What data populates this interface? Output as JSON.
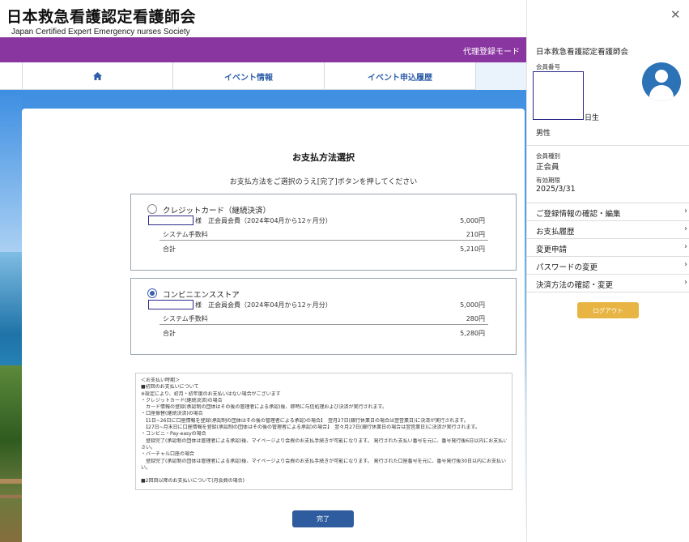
{
  "header": {
    "org_jp": "日本救急看護認定看護師会",
    "org_en": "Japan Certified Expert Emergency nurses Society",
    "mode_label": "代理登録モード"
  },
  "nav": {
    "home_icon": "home-icon",
    "items": [
      "イベント情報",
      "イベント申込履歴"
    ]
  },
  "main": {
    "title": "お支払方法選択",
    "instruction": "お支払方法をご選択のうえ[完了]ボタンを押してください",
    "options": [
      {
        "label": "クレジットカード（継続決済）",
        "selected": false,
        "fee_line": "様　正会員会費（2024年04月から12ヶ月分）",
        "fee_value": "5,000円",
        "system_fee_label": "システム手数料",
        "system_fee_value": "210円",
        "total_label": "合計",
        "total_value": "5,210円"
      },
      {
        "label": "コンビニエンスストア",
        "selected": true,
        "fee_line": "様　正会員会費（2024年04月から12ヶ月分）",
        "fee_value": "5,000円",
        "system_fee_label": "システム手数料",
        "system_fee_value": "280円",
        "total_label": "合計",
        "total_value": "5,280円"
      }
    ],
    "notes": [
      "＜お支払い時期＞",
      "■初回のお支払いについて",
      "※設定により、初月・初年度のお支払いはない場合がございます",
      "・クレジットカード(継続決済)の場合",
      "　カード情報の登録(承認制の団体はその後の管理者による承認)後、即時に与信処理および決済が実行されます。",
      "・口座振替(継続決済)の場合",
      "　【1日~26日に口座情報を登録(承認制の団体はその後の管理者による承認)の場合】　翌月27日(銀行休業日の場合は翌営業日)に決済が実行されます。",
      "　【27日~月末日に口座情報を登録(承認制の団体はその後の管理者による承認)の場合】　翌々月27日(銀行休業日の場合は翌営業日)に決済が実行されます。",
      "・コンビニ・Pay-easyの場合",
      "　登録完了(承認制の団体は管理者による承認)後、マイページより会費のお支払手続きが可能になります。 発行された支払い番号を元に、番号発行後6日以内にお支払いくだ",
      "さい。",
      "・バーチャル口座の場合",
      "　登録完了(承認制の団体は管理者による承認)後、マイページより会費のお支払手続きが可能になります。 発行された口座番号を元に、番号発行後30日以内にお支払いくださ",
      "い。",
      "",
      "■2回目以降のお支払いについて(月会費の場合)"
    ],
    "done_label": "完了"
  },
  "panel": {
    "close_icon": "close-icon",
    "org_name": "日本救急看護認定看護師会",
    "member_no_label": "会員番号",
    "birth_suffix": "日生",
    "gender": "男性",
    "member_type_label": "会員種別",
    "member_type": "正会員",
    "expiry_label": "有効期限",
    "expiry": "2025/3/31",
    "menu": [
      "ご登録情報の確認・編集",
      "お支払履歴",
      "変更申請",
      "パスワードの変更",
      "決済方法の確認・変更"
    ],
    "logout_label": "ログアウト"
  },
  "colors": {
    "purple": "#8a36a0",
    "nav_text": "#2f5ea8",
    "button_blue": "#2f5c9e",
    "logout": "#e8b545",
    "avatar": "#2c72b6"
  }
}
